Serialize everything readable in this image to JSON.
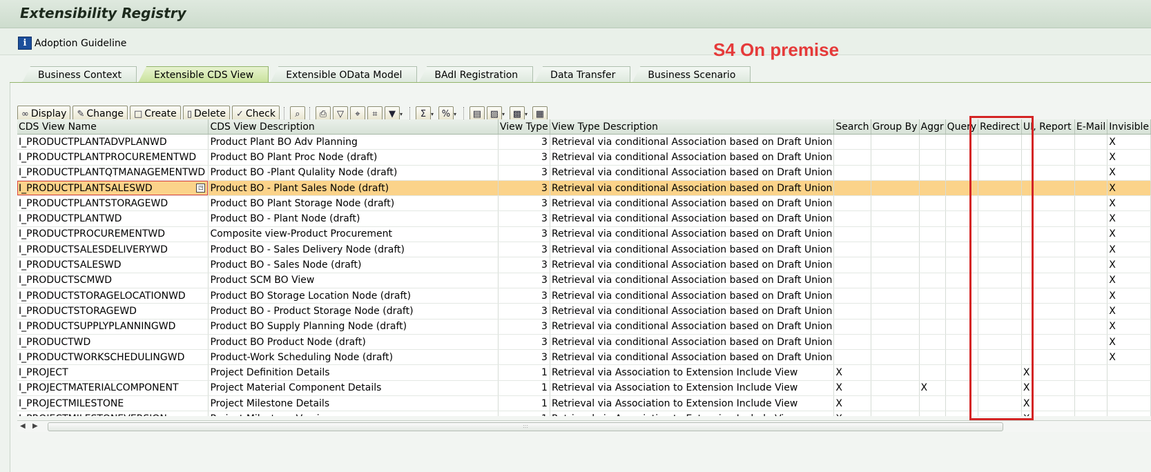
{
  "app": {
    "title": "Extensibility Registry",
    "guideline": "Adoption Guideline",
    "overlay_note": "S4 On premise"
  },
  "tabs": [
    {
      "label": "Business Context",
      "active": false
    },
    {
      "label": "Extensible CDS View",
      "active": true
    },
    {
      "label": "Extensible OData Model",
      "active": false
    },
    {
      "label": "BAdI Registration",
      "active": false
    },
    {
      "label": "Data Transfer",
      "active": false
    },
    {
      "label": "Business Scenario",
      "active": false
    }
  ],
  "toolbar": {
    "display": "Display",
    "change": "Change",
    "create": "Create",
    "delete": "Delete",
    "check": "Check"
  },
  "columns": [
    "CDS View Name",
    "CDS View Description",
    "View Type",
    "View Type Description",
    "Search",
    "Group By",
    "Aggr",
    "Query",
    "Redirect",
    "UI, Report",
    "E-Mail",
    "Invisible"
  ],
  "rows": [
    [
      "I_PRODUCTPLANTADVPLANWD",
      "Product Plant BO Adv Planning",
      "3",
      "Retrieval via conditional Association based on Draft Union",
      "",
      "",
      "",
      "",
      "",
      "",
      "",
      "X"
    ],
    [
      "I_PRODUCTPLANTPROCUREMENTWD",
      "Product BO Plant Proc Node (draft)",
      "3",
      "Retrieval via conditional Association based on Draft Union",
      "",
      "",
      "",
      "",
      "",
      "",
      "",
      "X"
    ],
    [
      "I_PRODUCTPLANTQTMANAGEMENTWD",
      "Product BO -Plant Qulality Node (draft)",
      "3",
      "Retrieval via conditional Association based on Draft Union",
      "",
      "",
      "",
      "",
      "",
      "",
      "",
      "X"
    ],
    [
      "I_PRODUCTPLANTSALESWD",
      "Product BO - Plant Sales Node (draft)",
      "3",
      "Retrieval via conditional Association based on Draft Union",
      "",
      "",
      "",
      "",
      "",
      "",
      "",
      "X"
    ],
    [
      "I_PRODUCTPLANTSTORAGEWD",
      "Product BO Plant Storage Node (draft)",
      "3",
      "Retrieval via conditional Association based on Draft Union",
      "",
      "",
      "",
      "",
      "",
      "",
      "",
      "X"
    ],
    [
      "I_PRODUCTPLANTWD",
      "Product BO - Plant Node (draft)",
      "3",
      "Retrieval via conditional Association based on Draft Union",
      "",
      "",
      "",
      "",
      "",
      "",
      "",
      "X"
    ],
    [
      "I_PRODUCTPROCUREMENTWD",
      "Composite view-Product Procurement",
      "3",
      "Retrieval via conditional Association based on Draft Union",
      "",
      "",
      "",
      "",
      "",
      "",
      "",
      "X"
    ],
    [
      "I_PRODUCTSALESDELIVERYWD",
      "Product BO - Sales Delivery Node (draft)",
      "3",
      "Retrieval via conditional Association based on Draft Union",
      "",
      "",
      "",
      "",
      "",
      "",
      "",
      "X"
    ],
    [
      "I_PRODUCTSALESWD",
      "Product BO - Sales Node (draft)",
      "3",
      "Retrieval via conditional Association based on Draft Union",
      "",
      "",
      "",
      "",
      "",
      "",
      "",
      "X"
    ],
    [
      "I_PRODUCTSCMWD",
      "Product SCM BO View",
      "3",
      "Retrieval via conditional Association based on Draft Union",
      "",
      "",
      "",
      "",
      "",
      "",
      "",
      "X"
    ],
    [
      "I_PRODUCTSTORAGELOCATIONWD",
      "Product BO Storage Location Node (draft)",
      "3",
      "Retrieval via conditional Association based on Draft Union",
      "",
      "",
      "",
      "",
      "",
      "",
      "",
      "X"
    ],
    [
      "I_PRODUCTSTORAGEWD",
      "Product BO - Product Storage Node (draft)",
      "3",
      "Retrieval via conditional Association based on Draft Union",
      "",
      "",
      "",
      "",
      "",
      "",
      "",
      "X"
    ],
    [
      "I_PRODUCTSUPPLYPLANNINGWD",
      "Product BO Supply Planning Node (draft)",
      "3",
      "Retrieval via conditional Association based on Draft Union",
      "",
      "",
      "",
      "",
      "",
      "",
      "",
      "X"
    ],
    [
      "I_PRODUCTWD",
      "Product BO Product Node (draft)",
      "3",
      "Retrieval via conditional Association based on Draft Union",
      "",
      "",
      "",
      "",
      "",
      "",
      "",
      "X"
    ],
    [
      "I_PRODUCTWORKSCHEDULINGWD",
      "Product-Work Scheduling Node (draft)",
      "3",
      "Retrieval via conditional Association based on Draft Union",
      "",
      "",
      "",
      "",
      "",
      "",
      "",
      "X"
    ],
    [
      "I_PROJECT",
      "Project Definition Details",
      "1",
      "Retrieval via Association to Extension Include View",
      "X",
      "",
      "",
      "",
      "",
      "X",
      "",
      ""
    ],
    [
      "I_PROJECTMATERIALCOMPONENT",
      "Project Material Component Details",
      "1",
      "Retrieval via Association to Extension Include View",
      "X",
      "",
      "X",
      "",
      "",
      "X",
      "",
      ""
    ],
    [
      "I_PROJECTMILESTONE",
      "Project Milestone Details",
      "1",
      "Retrieval via Association to Extension Include View",
      "X",
      "",
      "",
      "",
      "",
      "X",
      "",
      ""
    ],
    [
      "I_PROJECTMILESTONEVERSION",
      "Project Milestone Version",
      "1",
      "Retrieval via Association to Extension Include View",
      "X",
      "",
      "",
      "",
      "",
      "X",
      "",
      ""
    ]
  ],
  "selected_row": 3,
  "colors": {
    "selection": "#fbd38a",
    "active_tab": "#c8e19a",
    "highlight_box": "#d42424"
  }
}
